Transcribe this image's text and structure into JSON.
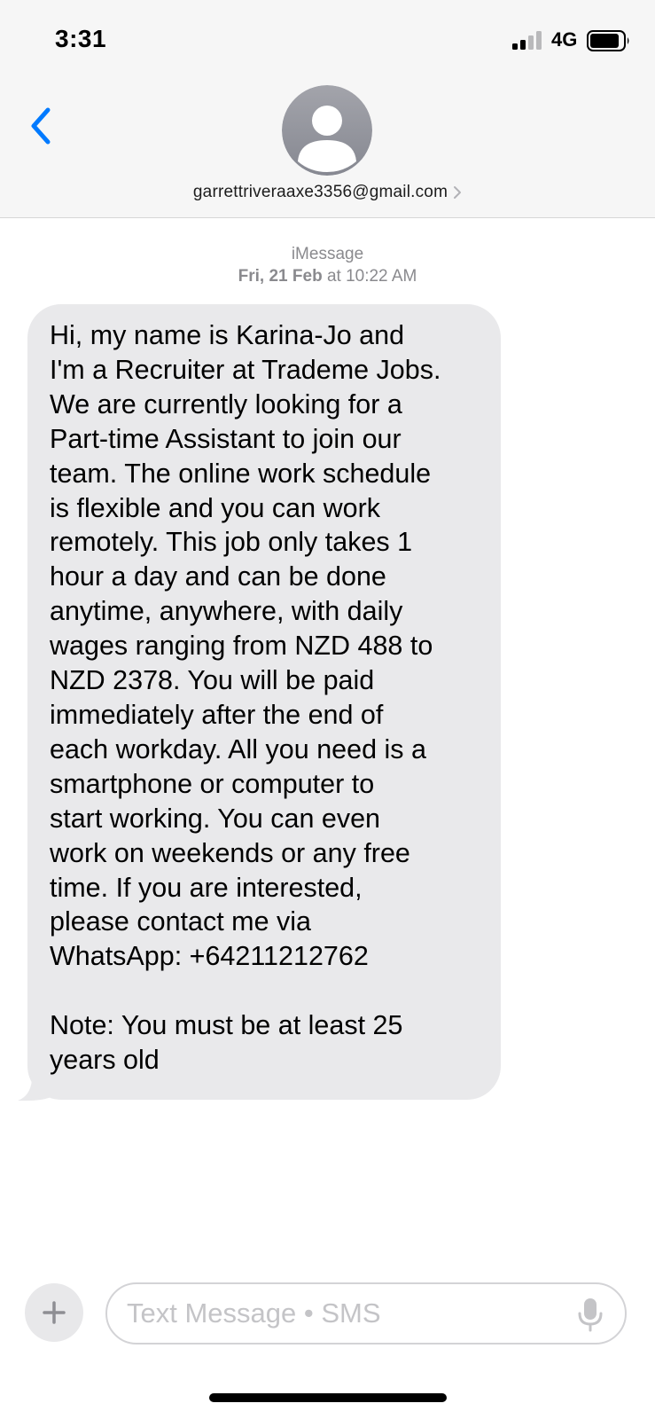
{
  "status_bar": {
    "time": "3:31",
    "network": "4G",
    "signal_bars_filled": 2,
    "signal_bars_total": 4
  },
  "header": {
    "back_icon": "chevron-left-icon",
    "avatar_icon": "person-icon",
    "contact": "garrettriveraaxe3356@gmail.com"
  },
  "conversation": {
    "service": "iMessage",
    "date": "Fri, 21 Feb",
    "time_prefix": " at ",
    "time": "10:22 AM"
  },
  "message": {
    "text": "Hi, my name is Karina-Jo and\nI'm a Recruiter at Trademe Jobs.\nWe are currently looking for a\nPart-time Assistant to join our\nteam. The online work schedule\nis flexible and you can work\nremotely. This job only takes 1\nhour a day and can be done\nanytime, anywhere, with daily\nwages ranging from NZD 488 to\nNZD 2378. You will be paid\nimmediately after the end of\neach workday. All you need is a\nsmartphone or computer to\nstart working. You can even\nwork on weekends or any free\ntime. If you are interested,\nplease contact me via\nWhatsApp: +64211212762\n\nNote: You must be at least 25\nyears old"
  },
  "composer": {
    "placeholder": "Text Message • SMS",
    "value": "",
    "plus_icon": "plus-icon",
    "mic_icon": "microphone-icon"
  },
  "colors": {
    "ios_blue": "#007AFF",
    "bubble_gray": "#E9E9EB",
    "header_bg": "#F6F6F6",
    "meta_gray": "#8A8A8E"
  }
}
